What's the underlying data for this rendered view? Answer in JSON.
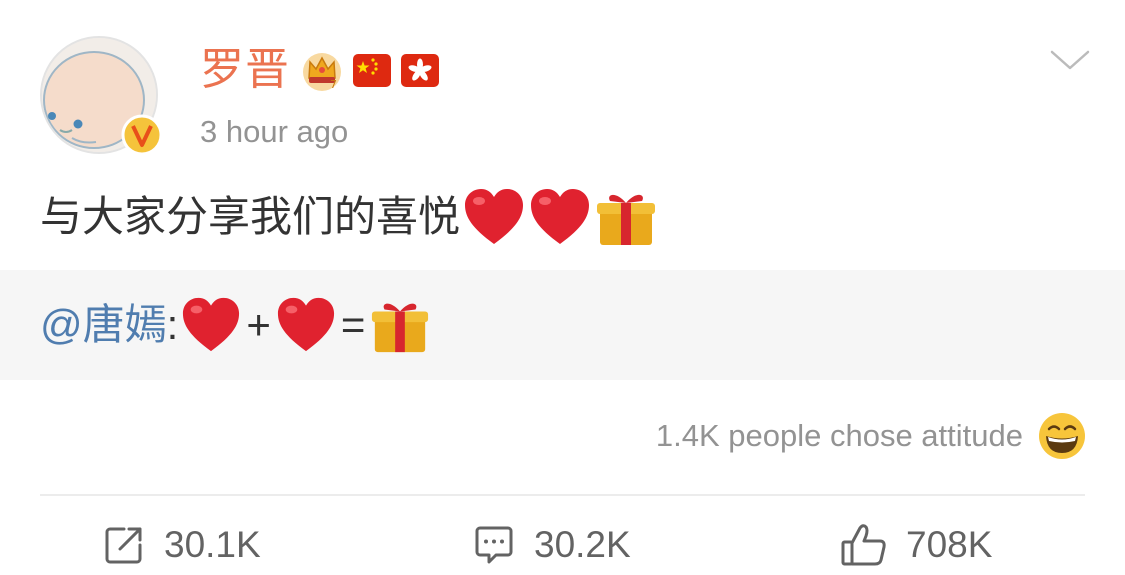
{
  "post": {
    "username": "罗晋",
    "timestamp": "3 hour ago",
    "badges": [
      "crown-badge-icon",
      "china-flag-icon",
      "hong-kong-flag-icon"
    ],
    "text": "与大家分享我们的喜悦",
    "text_emojis": [
      "red-heart-icon",
      "red-heart-icon",
      "gift-icon"
    ],
    "quote": {
      "mention": "@唐嫣",
      "colon": ":",
      "plus": "+",
      "equals": "="
    },
    "attitude": {
      "text": "1.4K people chose attitude",
      "icon": "grinning-face-icon"
    },
    "actions": {
      "repost": {
        "count": "30.1K",
        "icon": "repost-icon"
      },
      "comment": {
        "count": "30.2K",
        "icon": "comment-icon"
      },
      "like": {
        "count": "708K",
        "icon": "thumbs-up-icon"
      }
    }
  },
  "colors": {
    "username": "#eb7350",
    "mention": "#507daf",
    "muted": "#939393",
    "body_text": "#333333",
    "quote_bg": "#f6f6f6"
  }
}
